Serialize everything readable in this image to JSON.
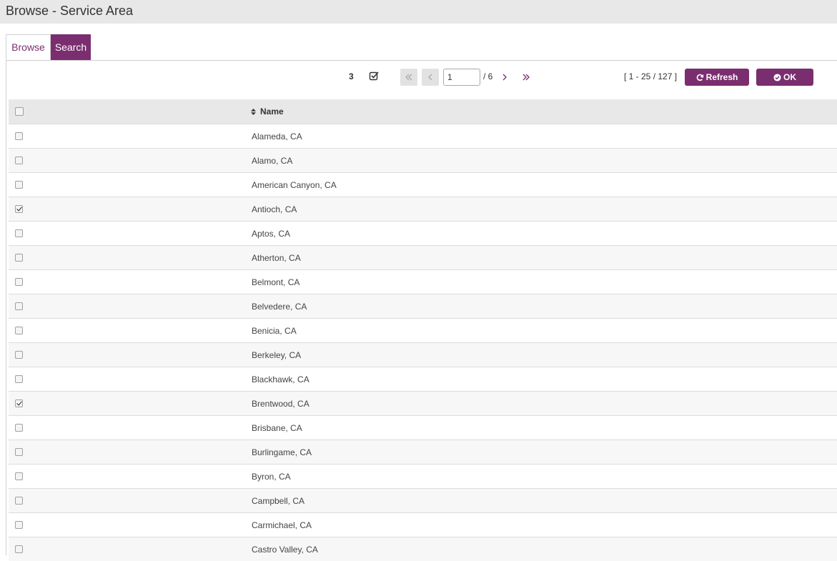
{
  "window": {
    "title": "Browse - Service Area"
  },
  "tabs": [
    {
      "label": "Browse",
      "active": true
    },
    {
      "label": "Search",
      "active": false
    }
  ],
  "toolbar": {
    "selected_count": "3",
    "page_input_value": "1",
    "page_total": "/ 6",
    "range_text": "[ 1 - 25 / 127 ]",
    "refresh_label": "Refresh",
    "ok_label": "OK"
  },
  "colors": {
    "accent": "#7a2e6f",
    "header_bg": "#e8e8e8"
  },
  "grid": {
    "columns": [
      {
        "label": "",
        "type": "select"
      },
      {
        "label": "Name",
        "sortable": true
      }
    ],
    "rows": [
      {
        "name": "Alameda, CA",
        "checked": false
      },
      {
        "name": "Alamo, CA",
        "checked": false
      },
      {
        "name": "American Canyon, CA",
        "checked": false
      },
      {
        "name": "Antioch, CA",
        "checked": true
      },
      {
        "name": "Aptos, CA",
        "checked": false
      },
      {
        "name": "Atherton, CA",
        "checked": false
      },
      {
        "name": "Belmont, CA",
        "checked": false
      },
      {
        "name": "Belvedere, CA",
        "checked": false
      },
      {
        "name": "Benicia, CA",
        "checked": false
      },
      {
        "name": "Berkeley, CA",
        "checked": false
      },
      {
        "name": "Blackhawk, CA",
        "checked": false
      },
      {
        "name": "Brentwood, CA",
        "checked": true
      },
      {
        "name": "Brisbane, CA",
        "checked": false
      },
      {
        "name": "Burlingame, CA",
        "checked": false
      },
      {
        "name": "Byron, CA",
        "checked": false
      },
      {
        "name": "Campbell, CA",
        "checked": false
      },
      {
        "name": "Carmichael, CA",
        "checked": false
      },
      {
        "name": "Castro Valley, CA",
        "checked": false
      }
    ]
  }
}
